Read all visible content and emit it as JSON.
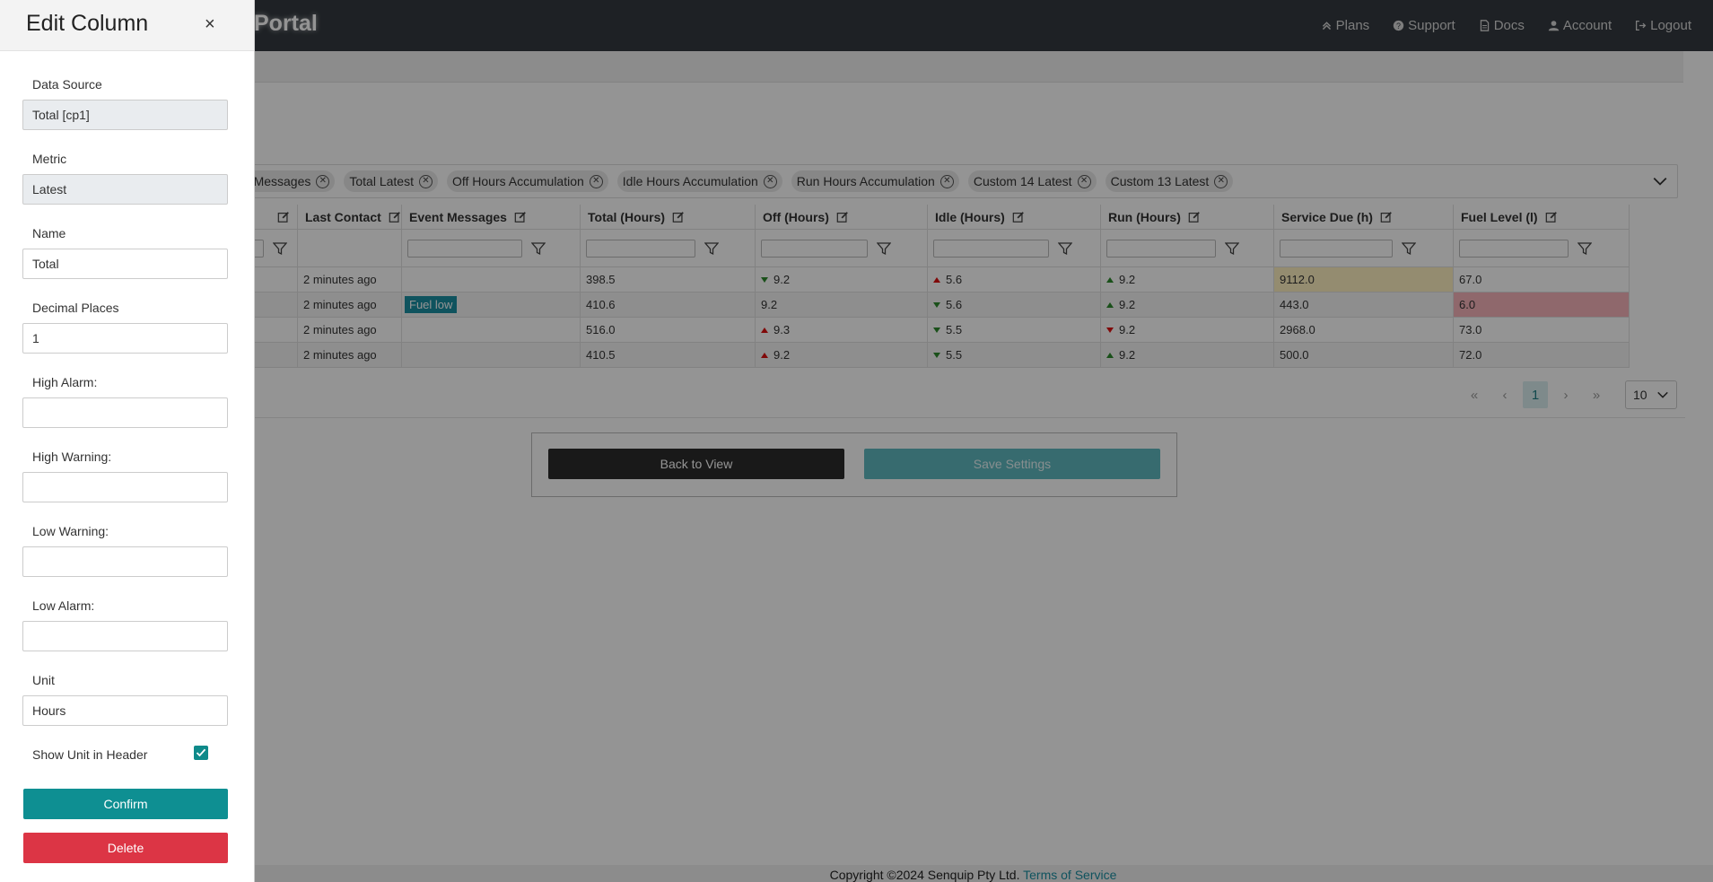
{
  "navbar": {
    "brand": "Portal",
    "links": [
      "Plans",
      "Support",
      "Docs",
      "Account",
      "Logout"
    ]
  },
  "chips": [
    "nt Messages",
    "Total Latest",
    "Off Hours Accumulation",
    "Idle Hours Accumulation",
    "Run Hours Accumulation",
    "Custom 14 Latest",
    "Custom 13 Latest"
  ],
  "table": {
    "headers": [
      "",
      "Last Contact",
      "Event Messages",
      "Total (Hours)",
      "Off (Hours)",
      "Idle (Hours)",
      "Run (Hours)",
      "Service Due (h)",
      "Fuel Level (l)"
    ],
    "rows": [
      {
        "last_contact": "2 minutes ago",
        "event": "",
        "total": "398.5",
        "off": "9.2",
        "off_trend": "down-green",
        "idle": "5.6",
        "idle_trend": "up-red",
        "run": "9.2",
        "run_trend": "up-green",
        "service": "9112.0",
        "service_state": "warn",
        "fuel": "67.0",
        "fuel_state": ""
      },
      {
        "last_contact": "2 minutes ago",
        "event": "Fuel low",
        "total": "410.6",
        "off": "9.2",
        "off_trend": "",
        "idle": "5.6",
        "idle_trend": "down-green",
        "run": "9.2",
        "run_trend": "up-green",
        "service": "443.0",
        "service_state": "",
        "fuel": "6.0",
        "fuel_state": "alarm"
      },
      {
        "last_contact": "2 minutes ago",
        "event": "",
        "total": "516.0",
        "off": "9.3",
        "off_trend": "up-red",
        "idle": "5.5",
        "idle_trend": "down-green",
        "run": "9.2",
        "run_trend": "down-red",
        "service": "2968.0",
        "service_state": "",
        "fuel": "73.0",
        "fuel_state": ""
      },
      {
        "last_contact": "2 minutes ago",
        "event": "",
        "total": "410.5",
        "off": "9.2",
        "off_trend": "up-red",
        "idle": "5.5",
        "idle_trend": "down-green",
        "run": "9.2",
        "run_trend": "up-green",
        "service": "500.0",
        "service_state": "",
        "fuel": "72.0",
        "fuel_state": ""
      }
    ]
  },
  "pager": {
    "current_page": "1",
    "page_size": "10"
  },
  "actions": {
    "back": "Back to View",
    "save": "Save Settings"
  },
  "footer": {
    "copyright": "Copyright ©2024 Senquip Pty Ltd.",
    "terms": "Terms of Service"
  },
  "panel": {
    "title": "Edit Column",
    "close": "×",
    "data_source_label": "Data Source",
    "data_source_value": "Total [cp1]",
    "metric_label": "Metric",
    "metric_value": "Latest",
    "name_label": "Name",
    "name_value": "Total",
    "decimal_label": "Decimal Places",
    "decimal_value": "1",
    "high_alarm_label": "High Alarm:",
    "high_alarm_value": "",
    "high_warning_label": "High Warning:",
    "high_warning_value": "",
    "low_warning_label": "Low Warning:",
    "low_warning_value": "",
    "low_alarm_label": "Low Alarm:",
    "low_alarm_value": "",
    "unit_label": "Unit",
    "unit_value": "Hours",
    "show_unit_label": "Show Unit in Header",
    "show_unit_checked": true,
    "confirm": "Confirm",
    "delete": "Delete"
  },
  "colors": {
    "accent": "#0e8f92",
    "danger": "#dc3545",
    "navbar": "#343a40"
  }
}
